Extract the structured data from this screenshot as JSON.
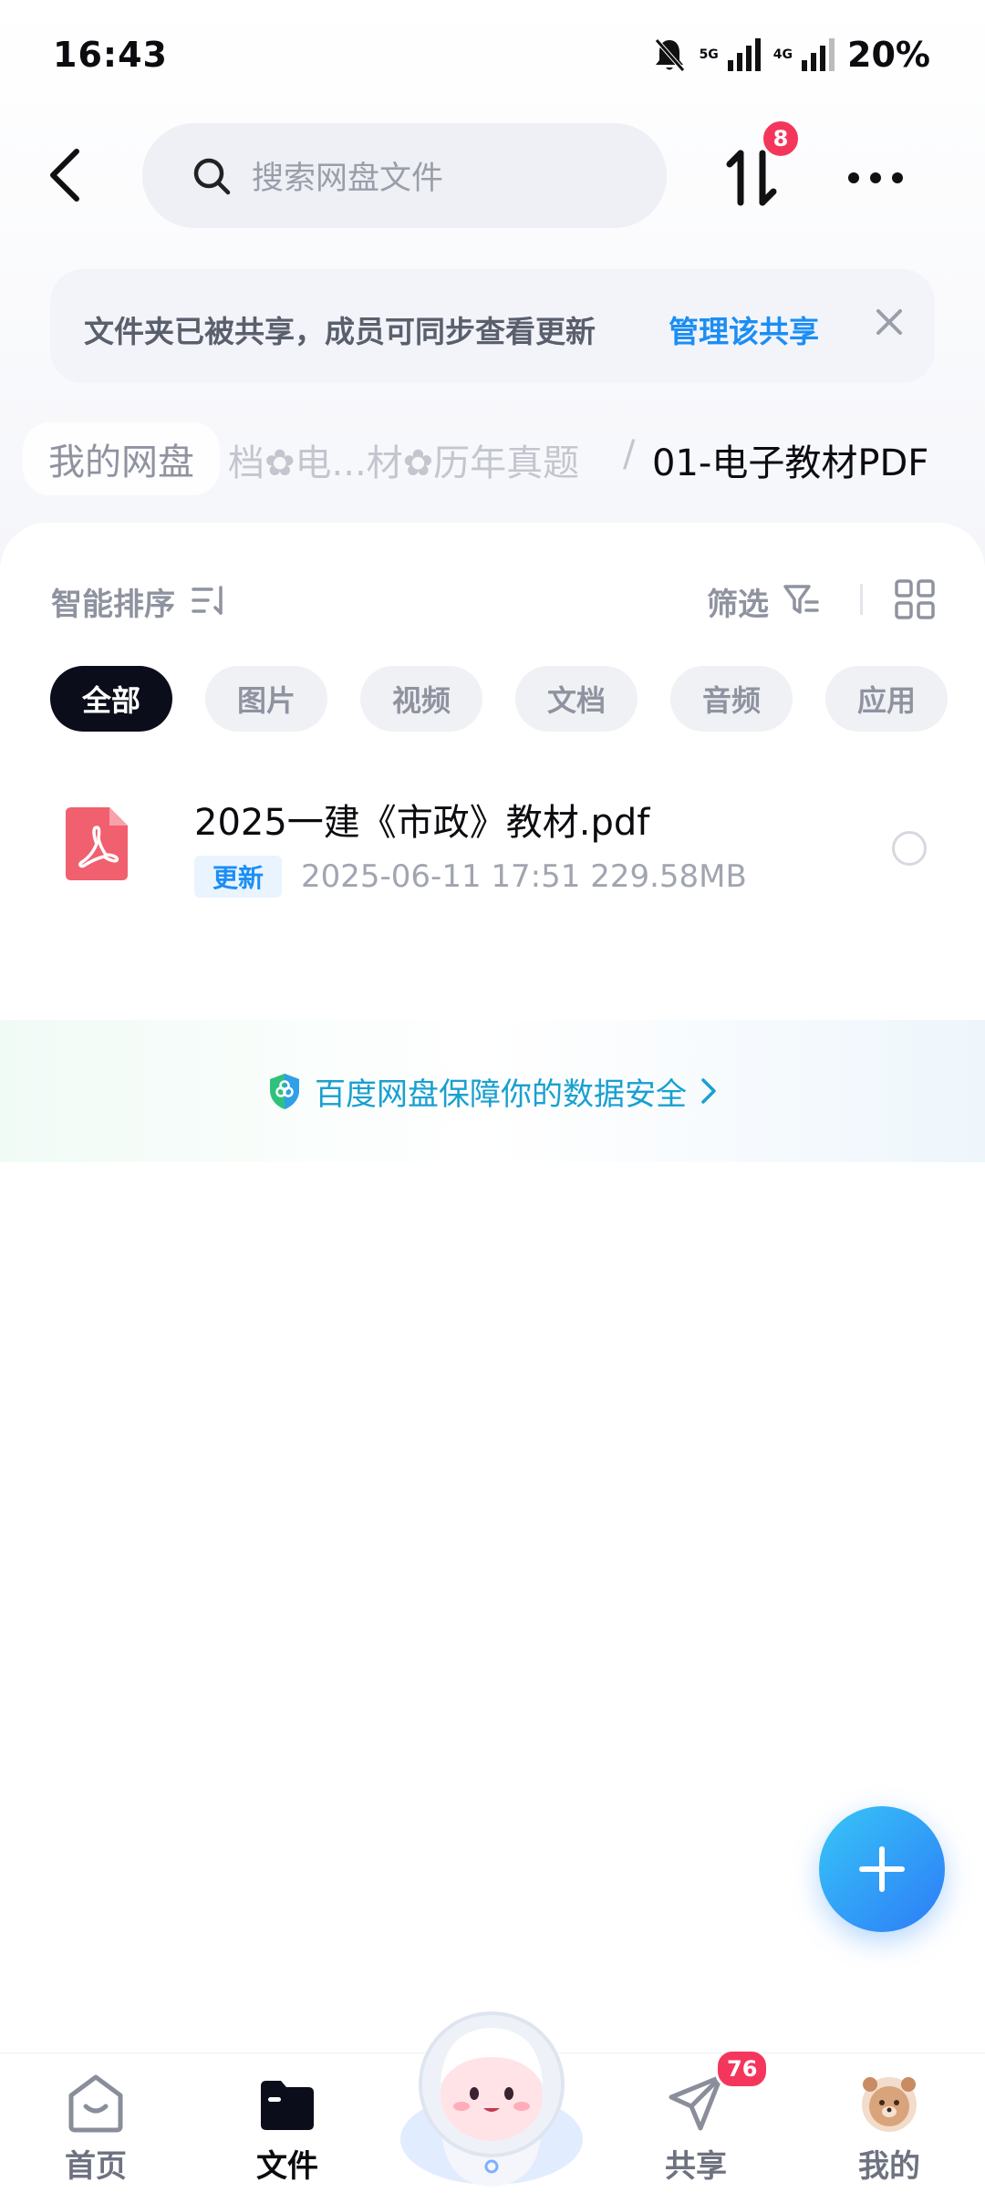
{
  "status_bar": {
    "time": "16:43",
    "network_1": "5G",
    "network_2": "4G",
    "battery": "20%",
    "icons": [
      "bell-muted-icon",
      "signal-icon",
      "signal-icon"
    ]
  },
  "header": {
    "search_placeholder": "搜索网盘文件",
    "transfer_badge": "8",
    "icons": [
      "back-arrow-icon",
      "search-icon",
      "transfer-icon",
      "more-icon"
    ]
  },
  "share_notice": {
    "text": "文件夹已被共享，成员可同步查看更新",
    "action": "管理该共享"
  },
  "breadcrumb": {
    "root": "我的网盘",
    "middle": "档✿电...材✿历年真题",
    "separator": "/",
    "current": "01-电子教材PDF"
  },
  "toolbar": {
    "sort_label": "智能排序",
    "filter_label": "筛选"
  },
  "chips": [
    {
      "label": "全部",
      "active": true
    },
    {
      "label": "图片",
      "active": false
    },
    {
      "label": "视频",
      "active": false
    },
    {
      "label": "文档",
      "active": false
    },
    {
      "label": "音频",
      "active": false
    },
    {
      "label": "应用",
      "active": false
    }
  ],
  "files": [
    {
      "name": "2025一建《市政》教材.pdf",
      "badge": "更新",
      "meta": "2025-06-11  17:51   229.58MB",
      "icon": "pdf-icon"
    }
  ],
  "safety_banner": {
    "text": "百度网盘保障你的数据安全"
  },
  "bottom_nav": {
    "items": [
      {
        "label": "首页",
        "icon": "home-icon"
      },
      {
        "label": "文件",
        "icon": "folder-icon"
      },
      {
        "label": "共享",
        "icon": "send-icon"
      },
      {
        "label": "我的",
        "icon": "avatar"
      }
    ],
    "share_badge": "76"
  },
  "colors": {
    "accent": "#1b8ef5",
    "badge": "#f5365c",
    "chip_active": "#0b0d1a",
    "pdf": "#f0606e"
  }
}
